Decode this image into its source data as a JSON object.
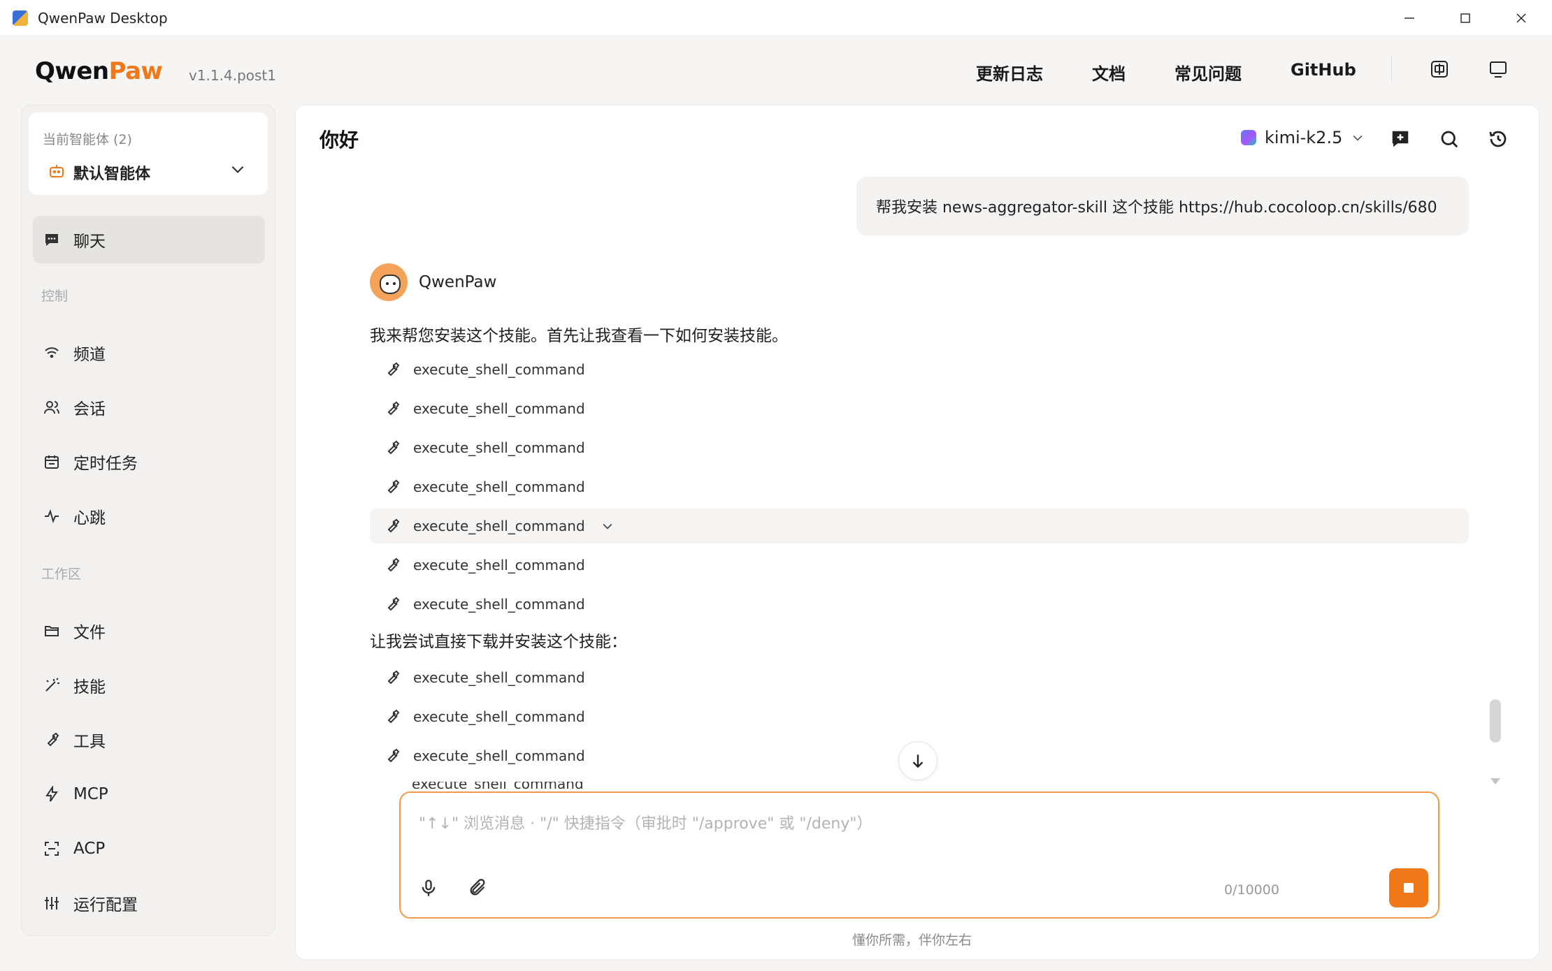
{
  "window": {
    "title": "QwenPaw Desktop"
  },
  "header": {
    "logo_prefix": "Qwen",
    "logo_suffix": "Paw",
    "version": "v1.1.4.post1",
    "nav": [
      "更新日志",
      "文档",
      "常见问题",
      "GitHub"
    ],
    "icons": [
      "language-icon",
      "monitor-icon"
    ]
  },
  "sidebar": {
    "agent_label": "当前智能体 (2)",
    "agent_name": "默认智能体",
    "chat_label": "聊天",
    "control_section": "控制",
    "control_items": [
      {
        "label": "频道",
        "icon": "wifi-icon"
      },
      {
        "label": "会话",
        "icon": "users-icon"
      },
      {
        "label": "定时任务",
        "icon": "calendar-icon"
      },
      {
        "label": "心跳",
        "icon": "pulse-icon"
      }
    ],
    "workspace_section": "工作区",
    "workspace_items": [
      {
        "label": "文件",
        "icon": "folder-icon"
      },
      {
        "label": "技能",
        "icon": "wand-icon"
      },
      {
        "label": "工具",
        "icon": "wrench-icon"
      },
      {
        "label": "MCP",
        "icon": "bolt-icon"
      },
      {
        "label": "ACP",
        "icon": "scan-icon"
      },
      {
        "label": "运行配置",
        "icon": "sliders-icon"
      }
    ]
  },
  "chat": {
    "title": "你好",
    "model": "kimi-k2.5",
    "user_message": "帮我安装 news-aggregator-skill 这个技能 https://hub.cocoloop.cn/skills/680",
    "bot_name": "QwenPaw",
    "bot_text_1": "我来帮您安装这个技能。首先让我查看一下如何安装技能。",
    "bot_text_2": "让我尝试直接下载并安装这个技能：",
    "tool_calls": [
      "execute_shell_command",
      "execute_shell_command",
      "execute_shell_command",
      "execute_shell_command",
      "execute_shell_command",
      "execute_shell_command",
      "execute_shell_command",
      "execute_shell_command",
      "execute_shell_command",
      "execute_shell_command",
      "execute_shell_command"
    ]
  },
  "composer": {
    "placeholder": "\"↑↓\" 浏览消息 · \"/\" 快捷指令（审批时 \"/approve\" 或 \"/deny\"）",
    "counter": "0/10000",
    "footnote": "懂你所需，伴你左右"
  },
  "colors": {
    "accent": "#f07818",
    "sidebar_bg": "#f2f1ef",
    "bubble_bg": "#f4f3f1"
  }
}
